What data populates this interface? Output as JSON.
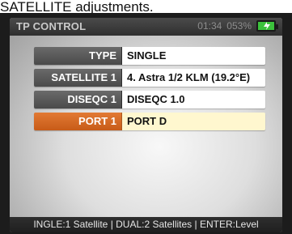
{
  "caption": "SATELLITE adjustments.",
  "screen": {
    "title": "TP CONTROL",
    "time": "01:34",
    "battery_percent": "053%",
    "battery_icon": "battery-charging-icon",
    "rows": [
      {
        "label": "TYPE",
        "value": "SINGLE",
        "selected": false
      },
      {
        "label": "SATELLITE 1",
        "value": "4. Astra 1/2 KLM (19.2°E)",
        "selected": false
      },
      {
        "label": "DISEQC 1",
        "value": "DISEQC 1.0",
        "selected": false
      },
      {
        "label": "PORT 1",
        "value": "PORT D",
        "selected": true
      }
    ],
    "footer": "INGLE:1 Satellite | DUAL:2 Satellites | ENTER:Level"
  },
  "colors": {
    "selected_label": "#d96a25",
    "selected_value": "#fff7cf",
    "label_bg": "#5a5a5a",
    "value_bg": "#ffffff",
    "battery_green": "#3cc23c"
  }
}
